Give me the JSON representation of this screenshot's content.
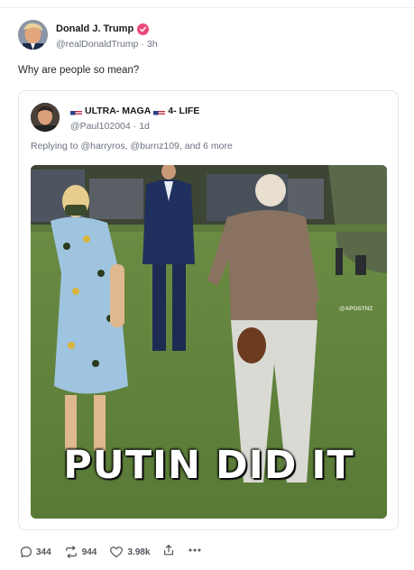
{
  "post": {
    "author_name": "Donald J. Trump",
    "author_handle": "@realDonaldTrump",
    "separator": "·",
    "time": "3h",
    "text": "Why are people so mean?",
    "verified_icon": "verified-badge-icon",
    "accent_color": "#ea4a7a"
  },
  "quote": {
    "author_name_part1": "ULTRA- MAGA",
    "author_name_part2": "4- LIFE",
    "flag_icon": "us-flag-icon",
    "author_handle": "@Paul102004",
    "separator": "·",
    "time": "1d",
    "reply_line": "Replying to @harryros, @burnz109, and 6 more",
    "image": {
      "caption": "PUTIN DID IT",
      "watermark": "@APOSTNZ"
    }
  },
  "actions": {
    "replies": "344",
    "reposts": "944",
    "likes": "3.98k",
    "icons": [
      "reply-icon",
      "repost-icon",
      "like-icon",
      "share-icon",
      "more-icon"
    ]
  }
}
